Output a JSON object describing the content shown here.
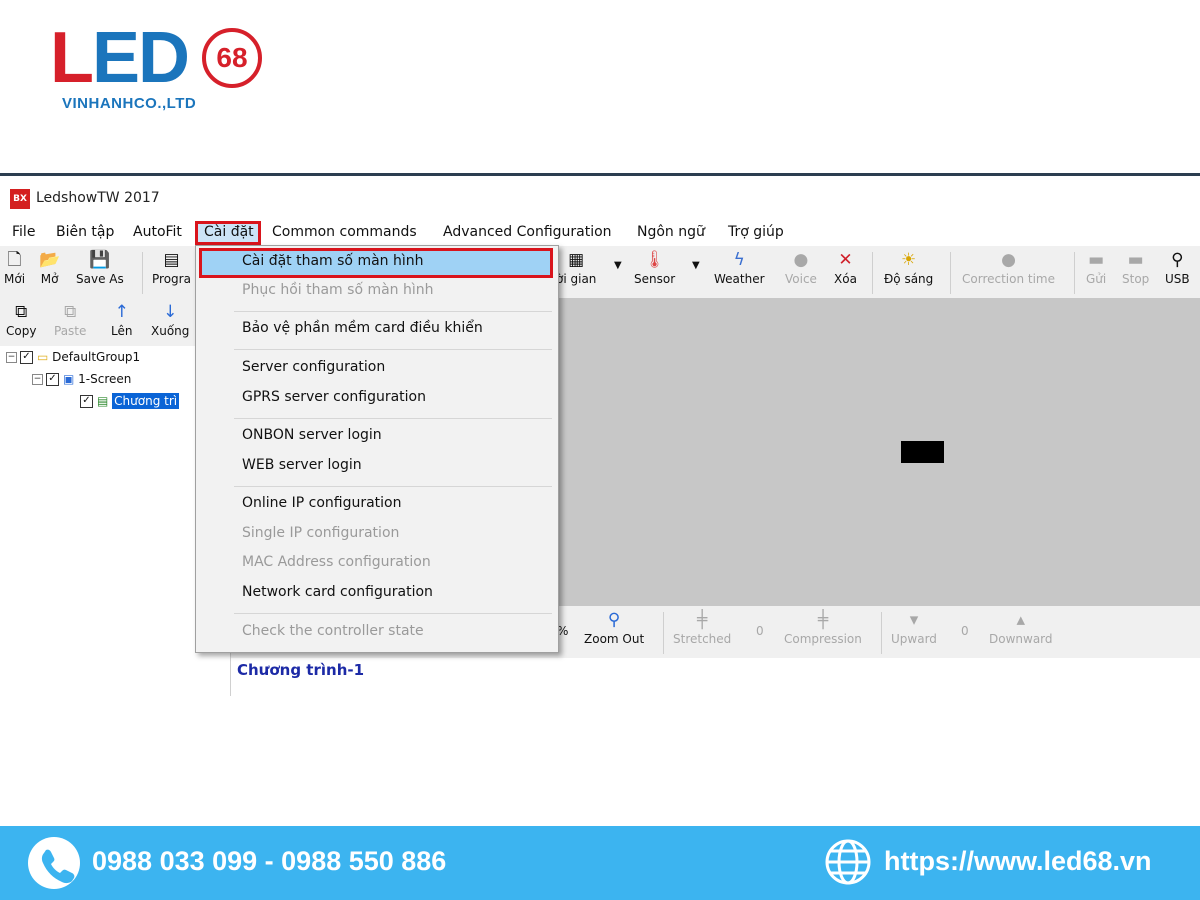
{
  "logo": {
    "letters_l": "L",
    "letters_e": "E",
    "letters_d": "D",
    "number": "68",
    "company": "VINHANHCO.,LTD"
  },
  "app": {
    "icon_text": "BX",
    "title": "LedshowTW 2017"
  },
  "menubar": [
    {
      "label": "File"
    },
    {
      "label": "Biên tập"
    },
    {
      "label": "AutoFit"
    },
    {
      "label": "Cài đặt"
    },
    {
      "label": "Common commands"
    },
    {
      "label": "Advanced Configuration"
    },
    {
      "label": "Ngôn ngữ"
    },
    {
      "label": "Trợ giúp"
    }
  ],
  "toolbar1": {
    "new": "Mới",
    "open": "Mở",
    "save_as": "Save As",
    "program": "Progra",
    "time": "ời gian",
    "sensor": "Sensor",
    "weather": "Weather",
    "voice": "Voice",
    "delete": "Xóa",
    "brightness": "Độ sáng",
    "correction_time": "Correction time",
    "send": "Gửi",
    "stop": "Stop",
    "usb": "USB"
  },
  "toolbar2": {
    "copy": "Copy",
    "paste": "Paste",
    "up": "Lên",
    "down": "Xuống"
  },
  "tree": {
    "group": "DefaultGroup1",
    "screen": "1-Screen",
    "program": "Chương trì"
  },
  "toolbar3": {
    "percent": "%",
    "zoom_out": "Zoom Out",
    "stretched": "Stretched",
    "stretched_val": "0",
    "compression": "Compression",
    "upward": "Upward",
    "upward_val": "0",
    "downward": "Downward"
  },
  "program_title": "Chương trình-1",
  "dropdown": [
    {
      "label": "Cài đặt tham số màn hình",
      "enabled": true,
      "highlighted": true
    },
    {
      "label": "Phục hồi tham số màn hình",
      "enabled": false
    },
    {
      "label": "Bảo vệ phần mềm card điều khiển",
      "enabled": true
    },
    {
      "label": "Server configuration",
      "enabled": true
    },
    {
      "label": "GPRS server configuration",
      "enabled": true
    },
    {
      "label": "ONBON server login",
      "enabled": true
    },
    {
      "label": "WEB server login",
      "enabled": true
    },
    {
      "label": "Online IP configuration",
      "enabled": true
    },
    {
      "label": "Single IP configuration",
      "enabled": false
    },
    {
      "label": "MAC Address configuration",
      "enabled": false
    },
    {
      "label": "Network card configuration",
      "enabled": true
    },
    {
      "label": "Check the controller state",
      "enabled": false
    }
  ],
  "footer": {
    "phones": "0988 033 099 - 0988 550 886",
    "website": "https://www.led68.vn",
    "bg_color": "#3cb4f0"
  },
  "icons": {
    "phone": "phone-icon",
    "globe": "globe-icon"
  }
}
